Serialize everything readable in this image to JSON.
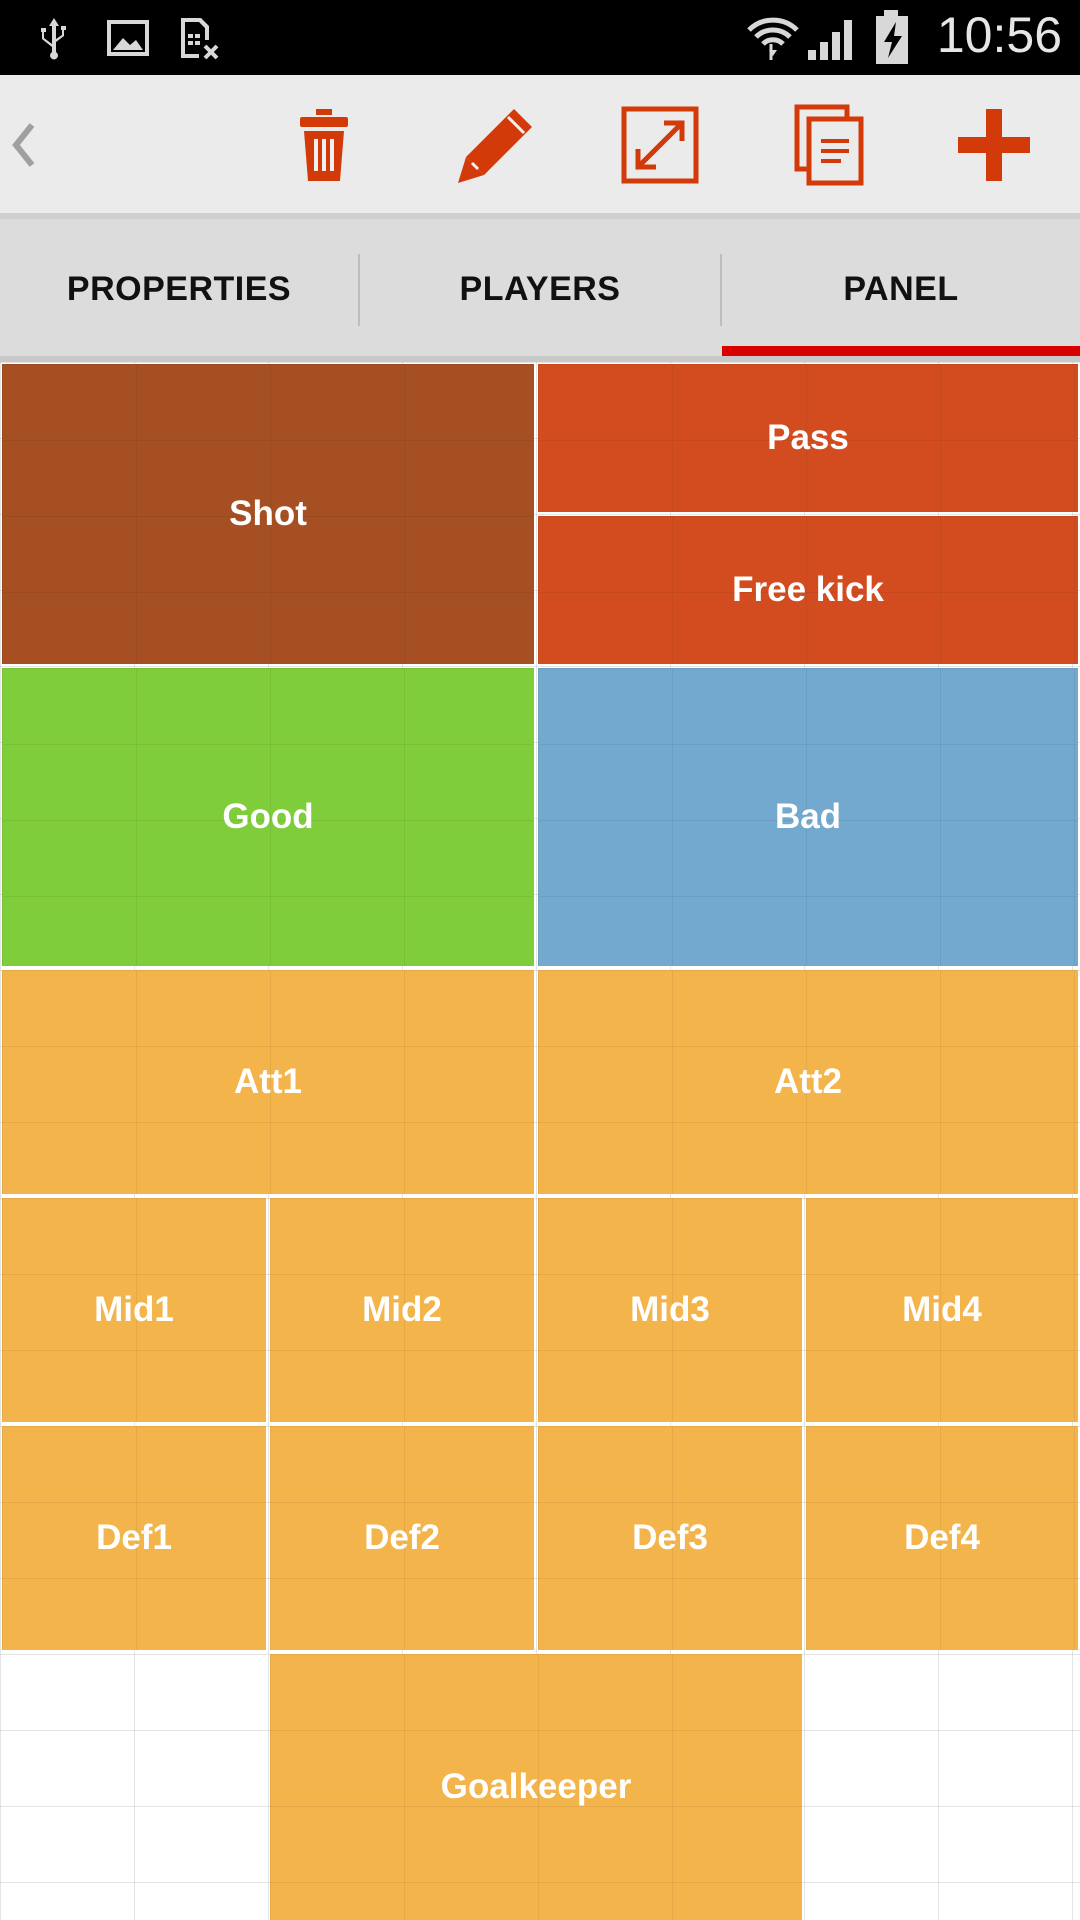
{
  "status_bar": {
    "time": "10:56",
    "left_icons": [
      "usb-icon",
      "image-icon",
      "no-sim-icon"
    ],
    "right_icons": [
      "wifi-icon",
      "signal-icon",
      "battery-charging-icon"
    ]
  },
  "toolbar": {
    "back_icon": "chevron-left-icon",
    "actions": [
      "delete-icon",
      "edit-pencil-icon",
      "resize-icon",
      "copy-icon",
      "add-icon"
    ],
    "accent": "#d23a0a"
  },
  "tabs": [
    {
      "label": "PROPERTIES",
      "selected": false
    },
    {
      "label": "PLAYERS",
      "selected": false
    },
    {
      "label": "PANEL",
      "selected": true
    }
  ],
  "tab_accent": "#d90000",
  "panel": {
    "tiles": {
      "shot": {
        "label": "Shot",
        "color": "#a64f22"
      },
      "pass": {
        "label": "Pass",
        "color": "#d24c1f"
      },
      "free_kick": {
        "label": "Free kick",
        "color": "#d24c1f"
      },
      "good": {
        "label": "Good",
        "color": "#7fcd3a"
      },
      "bad": {
        "label": "Bad",
        "color": "#73a8cf"
      },
      "att1": {
        "label": "Att1",
        "color": "#f3b54b"
      },
      "att2": {
        "label": "Att2",
        "color": "#f3b54b"
      },
      "mid1": {
        "label": "Mid1",
        "color": "#f3b54b"
      },
      "mid2": {
        "label": "Mid2",
        "color": "#f3b54b"
      },
      "mid3": {
        "label": "Mid3",
        "color": "#f3b54b"
      },
      "mid4": {
        "label": "Mid4",
        "color": "#f3b54b"
      },
      "def1": {
        "label": "Def1",
        "color": "#f3b54b"
      },
      "def2": {
        "label": "Def2",
        "color": "#f3b54b"
      },
      "def3": {
        "label": "Def3",
        "color": "#f3b54b"
      },
      "def4": {
        "label": "Def4",
        "color": "#f3b54b"
      },
      "goalkeeper": {
        "label": "Goalkeeper",
        "color": "#f3b54b"
      }
    }
  }
}
